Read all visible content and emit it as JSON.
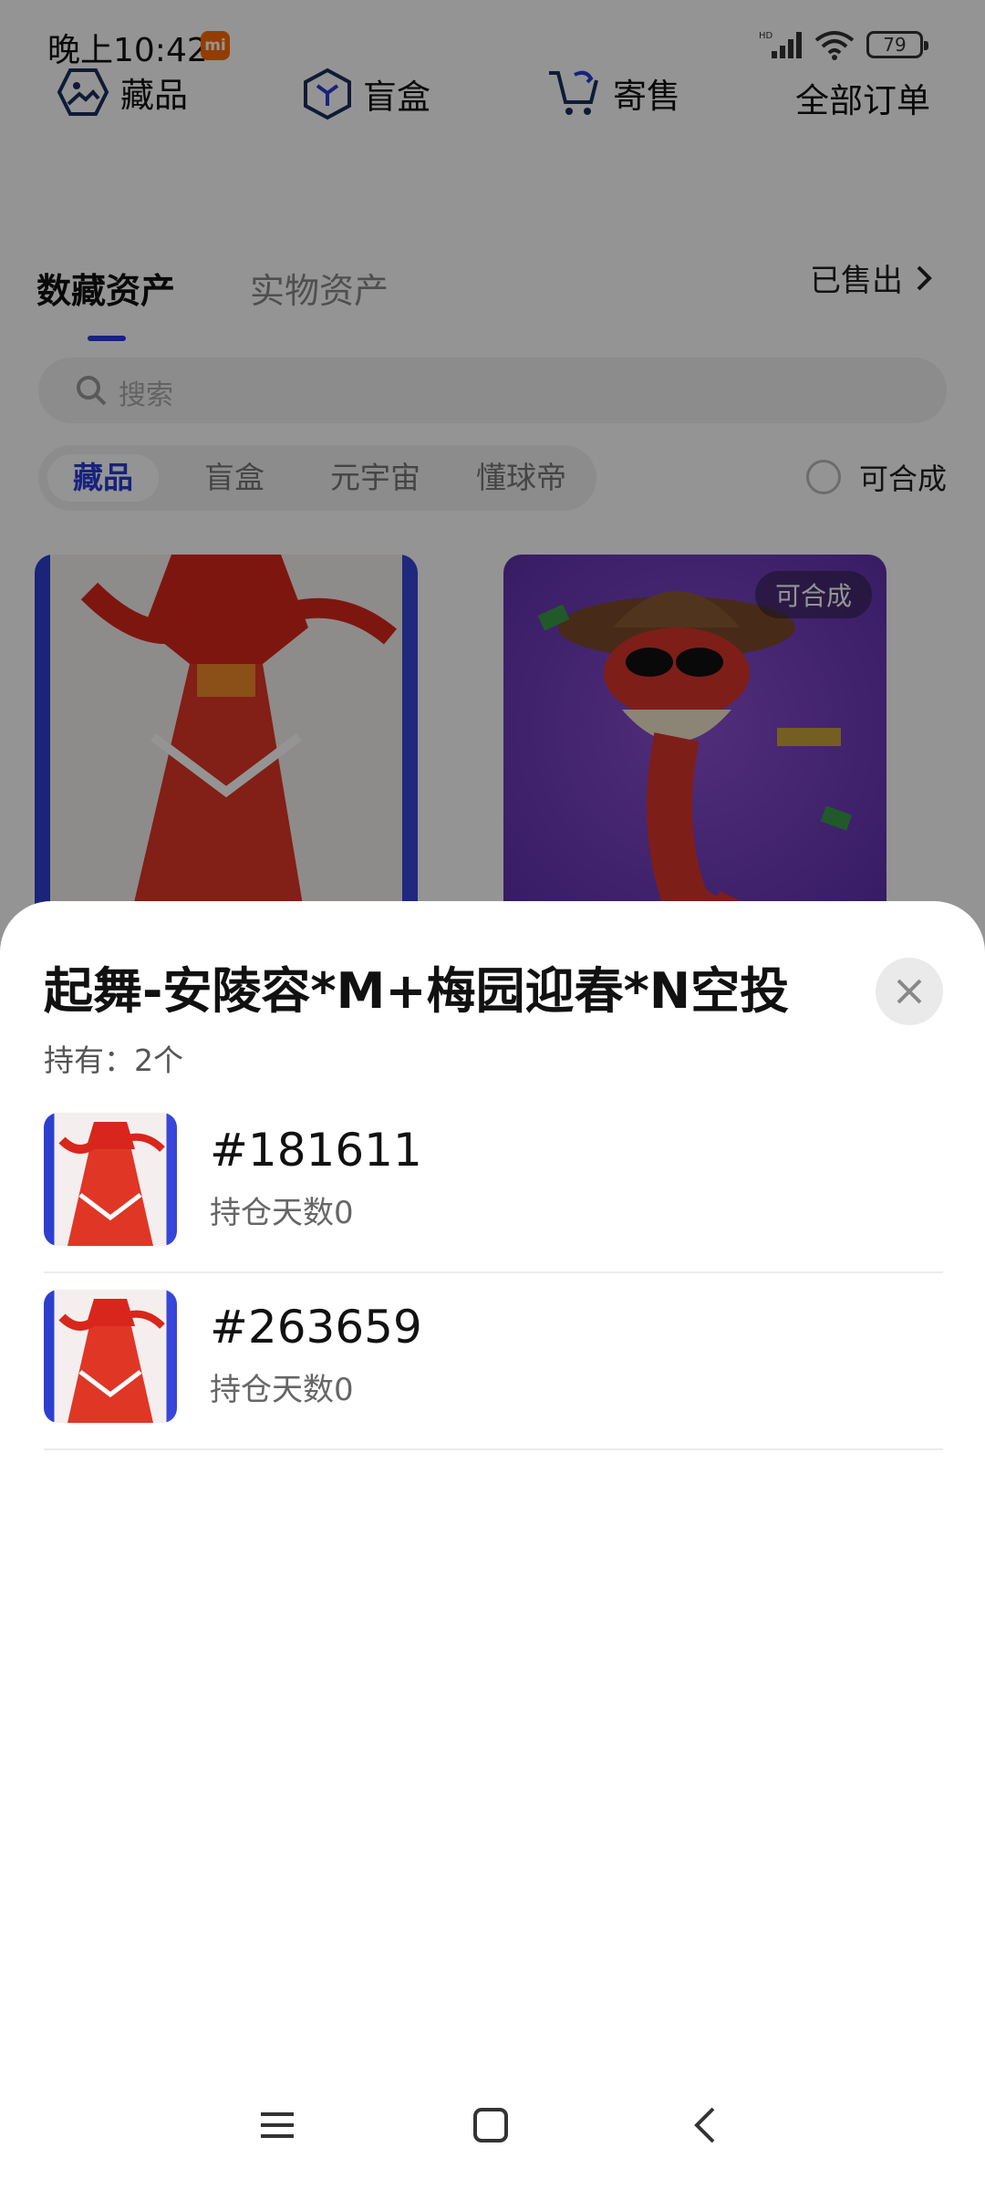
{
  "status_bar": {
    "time": "晚上10:42",
    "mi_badge": "mi",
    "battery": "79",
    "network": "HD"
  },
  "top_nav": {
    "items": [
      {
        "label": "藏品",
        "icon": "image-icon"
      },
      {
        "label": "盲盒",
        "icon": "cube-icon"
      },
      {
        "label": "寄售",
        "icon": "cart-icon"
      },
      {
        "label": "全部订单",
        "icon": ""
      }
    ]
  },
  "asset_tabs": {
    "active": "数藏资产",
    "inactive": "实物资产",
    "sold_link": "已售出"
  },
  "search": {
    "placeholder": "搜索"
  },
  "filters": {
    "chips": [
      "藏品",
      "盲盒",
      "元宇宙",
      "懂球帝"
    ],
    "active_index": 0,
    "composable_label": "可合成"
  },
  "cards": [
    {
      "name": "dancer-card",
      "badge": ""
    },
    {
      "name": "snake-cowboy-card",
      "badge": "可合成"
    }
  ],
  "sheet": {
    "title": "起舞-安陵容*M+梅园迎春*N空投",
    "holding": "持有：2个",
    "items": [
      {
        "serial": "#181611",
        "days": "持仓天数0"
      },
      {
        "serial": "#263659",
        "days": "持仓天数0"
      }
    ]
  },
  "colors": {
    "accent": "#2a3bd6",
    "overlay": "rgba(0,0,0,0.42)",
    "mi_orange": "#ff6a00"
  }
}
